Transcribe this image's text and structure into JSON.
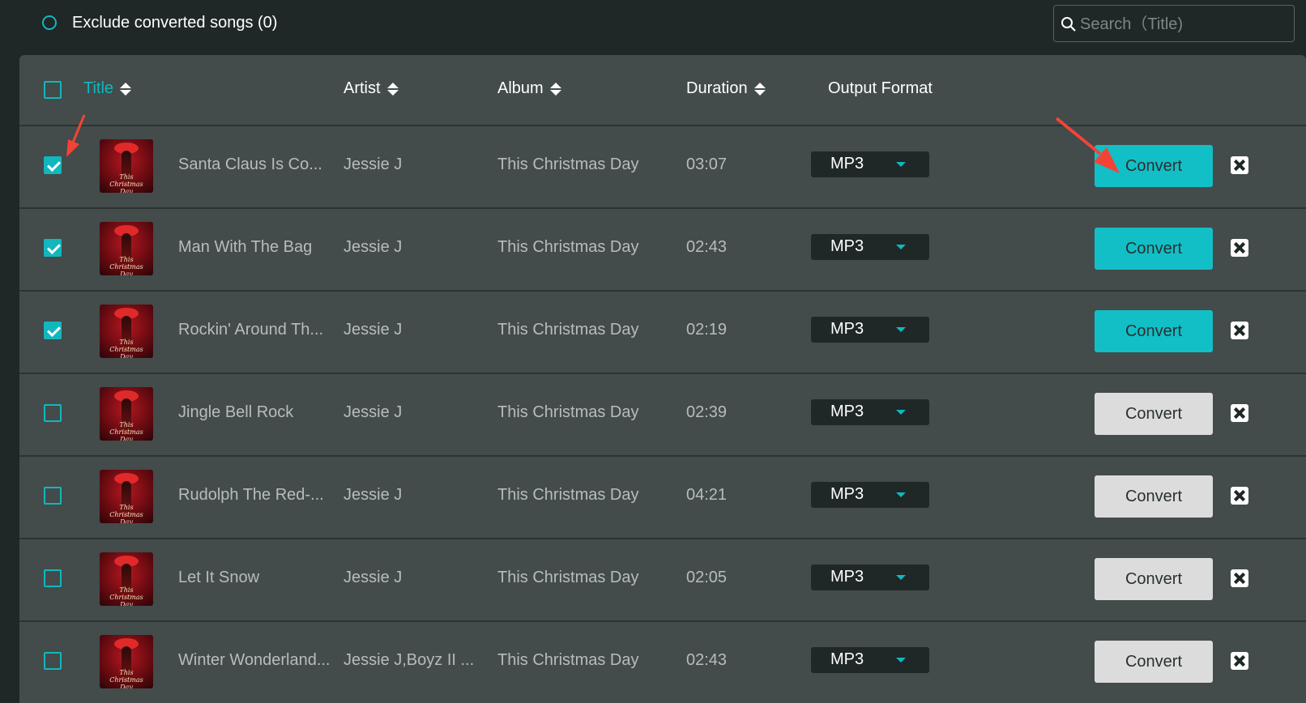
{
  "topbar": {
    "exclude_label": "Exclude converted songs (0)",
    "search_placeholder": "Search（Title)"
  },
  "header": {
    "title": "Title",
    "artist": "Artist",
    "album": "Album",
    "duration": "Duration",
    "output_format": "Output Format"
  },
  "rows": [
    {
      "title": "Santa Claus Is Co...",
      "artist": "Jessie J",
      "album": "This Christmas Day",
      "duration": "03:07",
      "format": "MP3",
      "convert": "Convert",
      "checked": true
    },
    {
      "title": "Man With The Bag",
      "artist": "Jessie J",
      "album": "This Christmas Day",
      "duration": "02:43",
      "format": "MP3",
      "convert": "Convert",
      "checked": true
    },
    {
      "title": "Rockin' Around Th...",
      "artist": "Jessie J",
      "album": "This Christmas Day",
      "duration": "02:19",
      "format": "MP3",
      "convert": "Convert",
      "checked": true
    },
    {
      "title": "Jingle Bell Rock",
      "artist": "Jessie J",
      "album": "This Christmas Day",
      "duration": "02:39",
      "format": "MP3",
      "convert": "Convert",
      "checked": false
    },
    {
      "title": "Rudolph The Red-...",
      "artist": "Jessie J",
      "album": "This Christmas Day",
      "duration": "04:21",
      "format": "MP3",
      "convert": "Convert",
      "checked": false
    },
    {
      "title": "Let It Snow",
      "artist": "Jessie J",
      "album": "This Christmas Day",
      "duration": "02:05",
      "format": "MP3",
      "convert": "Convert",
      "checked": false
    },
    {
      "title": "Winter Wonderland...",
      "artist": "Jessie J,Boyz II ...",
      "album": "This Christmas Day",
      "duration": "02:43",
      "format": "MP3",
      "convert": "Convert",
      "checked": false
    }
  ],
  "colors": {
    "accent": "#12b7be",
    "background": "#1f2727",
    "panel": "#434b4b",
    "annotation_arrow": "#f44336"
  }
}
